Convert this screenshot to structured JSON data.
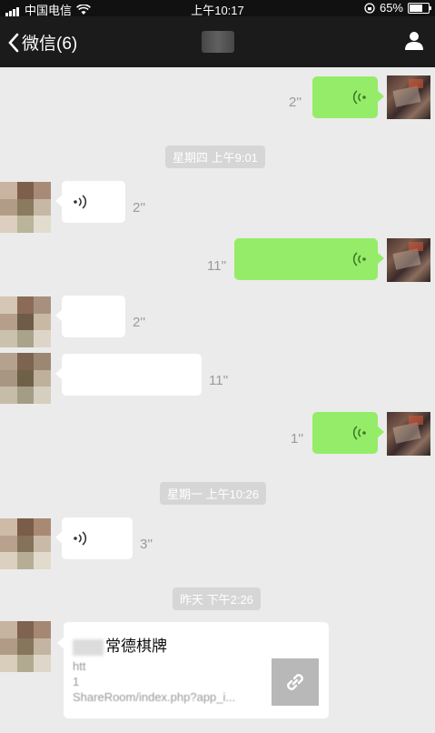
{
  "status_bar": {
    "carrier": "中国电信",
    "time": "上午10:17",
    "battery": "65%"
  },
  "nav": {
    "back_label": "微信(6)"
  },
  "messages": {
    "m1_duration": "2''",
    "ts1": "星期四 上午9:01",
    "m2_duration": "2''",
    "m3_duration": "11''",
    "m4_duration": "2''",
    "m5_duration": "11''",
    "m6_duration": "1''",
    "ts2": "星期一 上午10:26",
    "m7_duration": "3''",
    "ts3": "昨天 下午2:26"
  },
  "link_card": {
    "title": "常德棋牌",
    "desc_line1": "htt",
    "desc_line2": "1",
    "desc_line3": "ShareRoom/index.php?app_i..."
  },
  "colors": {
    "outgoing_bubble": "#95ec69",
    "incoming_bubble": "#ffffff",
    "chat_background": "#ebebeb",
    "nav_background": "#1b1b1b"
  }
}
